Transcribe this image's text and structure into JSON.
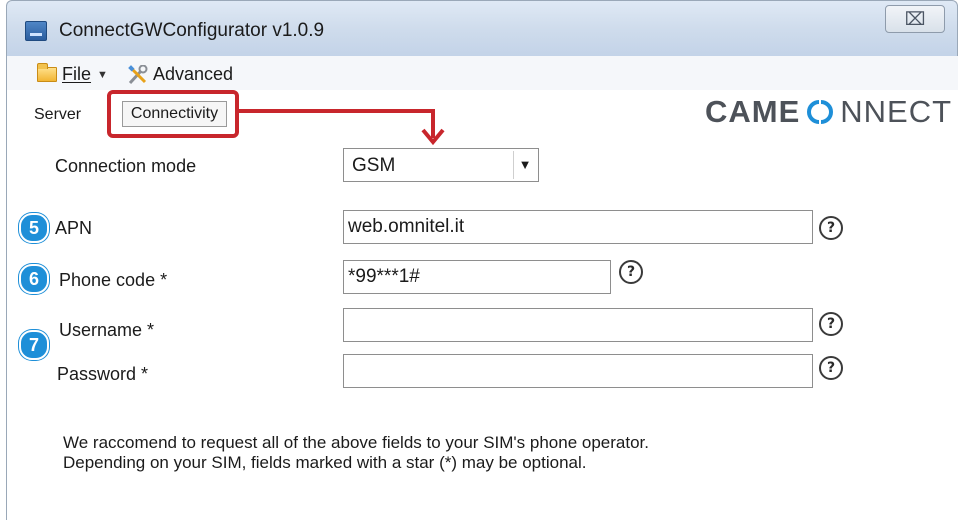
{
  "window": {
    "title": "ConnectGWConfigurator v1.0.9",
    "close_symbol": "⌧"
  },
  "menu": {
    "file_label": "File",
    "advanced_label": "Advanced"
  },
  "tabs": {
    "server": "Server",
    "connectivity": "Connectivity"
  },
  "logo": {
    "part_a": "CAME",
    "part_b": "NNECT"
  },
  "form": {
    "connection_mode_label": "Connection mode",
    "connection_mode_value": "GSM",
    "apn_label": "APN",
    "apn_value": "web.omnitel.it",
    "phone_code_label": "Phone code *",
    "phone_code_value": "*99***1#",
    "username_label": "Username *",
    "username_value": "",
    "password_label": "Password *",
    "password_value": "",
    "help_symbol": "?"
  },
  "badges": {
    "apn": "5",
    "phone_code": "6",
    "credentials": "7"
  },
  "note": {
    "line1": "We raccomend to request all of the above fields to your SIM's phone operator.",
    "line2": "Depending on your SIM, fields marked with a star (*) may be optional."
  },
  "colors": {
    "callout": "#c8262c",
    "badge": "#1e8fd8",
    "logo_accent": "#1e8fd8"
  },
  "icons": {
    "file_menu": "folder-icon",
    "advanced_menu": "tools-icon",
    "help": "help-icon"
  }
}
